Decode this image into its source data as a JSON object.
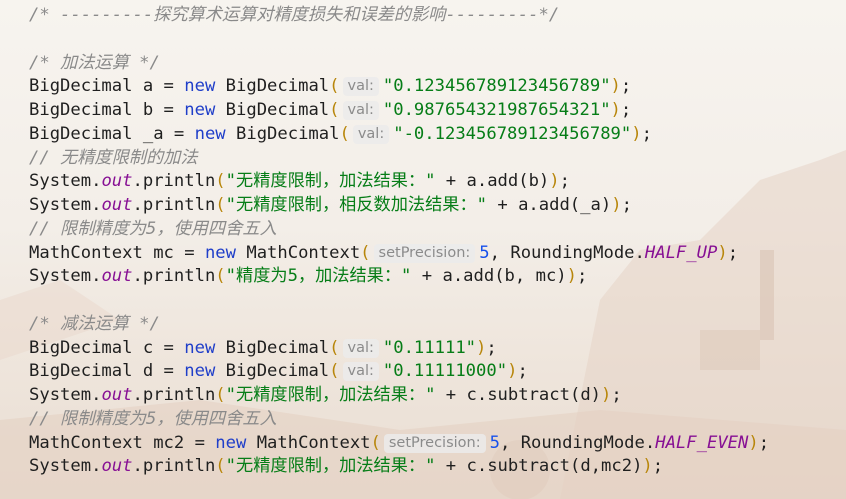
{
  "editor": {
    "lines": [
      {
        "kind": "comment",
        "text": "/* ---------探究算术运算对精度损失和误差的影响---------*/"
      },
      {
        "kind": "blank"
      },
      {
        "kind": "comment",
        "text": "/* 加法运算 */"
      },
      {
        "kind": "decl",
        "type": "BigDecimal",
        "var": "a",
        "ctor": "BigDecimal",
        "hint": "val:",
        "arg": "\"0.123456789123456789\""
      },
      {
        "kind": "decl",
        "type": "BigDecimal",
        "var": "b",
        "ctor": "BigDecimal",
        "hint": "val:",
        "arg": "\"0.987654321987654321\""
      },
      {
        "kind": "decl",
        "type": "BigDecimal",
        "var": "_a",
        "ctor": "BigDecimal",
        "hint": "val:",
        "arg": "\"-0.123456789123456789\""
      },
      {
        "kind": "comment",
        "text": "// 无精度限制的加法"
      },
      {
        "kind": "print",
        "str": "\"无精度限制，加法结果：\"",
        "expr": "a.add(b)"
      },
      {
        "kind": "print",
        "str": "\"无精度限制，相反数加法结果：\"",
        "expr": "a.add(_a)"
      },
      {
        "kind": "comment",
        "text": "// 限制精度为5，使用四舍五入"
      },
      {
        "kind": "mc",
        "var": "mc",
        "hint": "setPrecision:",
        "num": "5",
        "mode": "HALF_UP"
      },
      {
        "kind": "print",
        "str": "\"精度为5，加法结果：\"",
        "expr": "a.add(b, mc)"
      },
      {
        "kind": "blank"
      },
      {
        "kind": "comment",
        "text": "/* 减法运算 */"
      },
      {
        "kind": "decl",
        "type": "BigDecimal",
        "var": "c",
        "ctor": "BigDecimal",
        "hint": "val:",
        "arg": "\"0.11111\""
      },
      {
        "kind": "decl",
        "type": "BigDecimal",
        "var": "d",
        "ctor": "BigDecimal",
        "hint": "val:",
        "arg": "\"0.11111000\""
      },
      {
        "kind": "print",
        "str": "\"无精度限制，加法结果：\"",
        "expr": "c.subtract(d)"
      },
      {
        "kind": "comment",
        "text": "// 限制精度为5，使用四舍五入"
      },
      {
        "kind": "mc",
        "var": "mc2",
        "hint": "setPrecision:",
        "num": "5",
        "mode": "HALF_EVEN"
      },
      {
        "kind": "print",
        "str": "\"无精度限制，加法结果：\"",
        "expr": "c.subtract(d,mc2)"
      }
    ],
    "tokens": {
      "new": "new",
      "mathcontext": "MathContext",
      "roundingmode": "RoundingMode",
      "system": "System",
      "out": "out",
      "println": "println",
      "plus": "+"
    }
  }
}
